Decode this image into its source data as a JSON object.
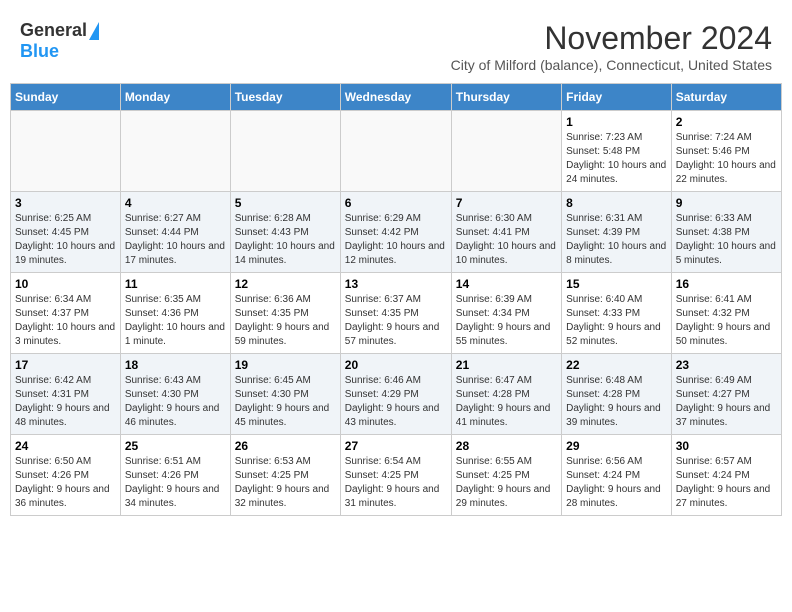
{
  "logo": {
    "general": "General",
    "blue": "Blue"
  },
  "title": "November 2024",
  "subtitle": "City of Milford (balance), Connecticut, United States",
  "days_of_week": [
    "Sunday",
    "Monday",
    "Tuesday",
    "Wednesday",
    "Thursday",
    "Friday",
    "Saturday"
  ],
  "weeks": [
    [
      {
        "day": "",
        "info": ""
      },
      {
        "day": "",
        "info": ""
      },
      {
        "day": "",
        "info": ""
      },
      {
        "day": "",
        "info": ""
      },
      {
        "day": "",
        "info": ""
      },
      {
        "day": "1",
        "info": "Sunrise: 7:23 AM\nSunset: 5:48 PM\nDaylight: 10 hours and 24 minutes."
      },
      {
        "day": "2",
        "info": "Sunrise: 7:24 AM\nSunset: 5:46 PM\nDaylight: 10 hours and 22 minutes."
      }
    ],
    [
      {
        "day": "3",
        "info": "Sunrise: 6:25 AM\nSunset: 4:45 PM\nDaylight: 10 hours and 19 minutes."
      },
      {
        "day": "4",
        "info": "Sunrise: 6:27 AM\nSunset: 4:44 PM\nDaylight: 10 hours and 17 minutes."
      },
      {
        "day": "5",
        "info": "Sunrise: 6:28 AM\nSunset: 4:43 PM\nDaylight: 10 hours and 14 minutes."
      },
      {
        "day": "6",
        "info": "Sunrise: 6:29 AM\nSunset: 4:42 PM\nDaylight: 10 hours and 12 minutes."
      },
      {
        "day": "7",
        "info": "Sunrise: 6:30 AM\nSunset: 4:41 PM\nDaylight: 10 hours and 10 minutes."
      },
      {
        "day": "8",
        "info": "Sunrise: 6:31 AM\nSunset: 4:39 PM\nDaylight: 10 hours and 8 minutes."
      },
      {
        "day": "9",
        "info": "Sunrise: 6:33 AM\nSunset: 4:38 PM\nDaylight: 10 hours and 5 minutes."
      }
    ],
    [
      {
        "day": "10",
        "info": "Sunrise: 6:34 AM\nSunset: 4:37 PM\nDaylight: 10 hours and 3 minutes."
      },
      {
        "day": "11",
        "info": "Sunrise: 6:35 AM\nSunset: 4:36 PM\nDaylight: 10 hours and 1 minute."
      },
      {
        "day": "12",
        "info": "Sunrise: 6:36 AM\nSunset: 4:35 PM\nDaylight: 9 hours and 59 minutes."
      },
      {
        "day": "13",
        "info": "Sunrise: 6:37 AM\nSunset: 4:35 PM\nDaylight: 9 hours and 57 minutes."
      },
      {
        "day": "14",
        "info": "Sunrise: 6:39 AM\nSunset: 4:34 PM\nDaylight: 9 hours and 55 minutes."
      },
      {
        "day": "15",
        "info": "Sunrise: 6:40 AM\nSunset: 4:33 PM\nDaylight: 9 hours and 52 minutes."
      },
      {
        "day": "16",
        "info": "Sunrise: 6:41 AM\nSunset: 4:32 PM\nDaylight: 9 hours and 50 minutes."
      }
    ],
    [
      {
        "day": "17",
        "info": "Sunrise: 6:42 AM\nSunset: 4:31 PM\nDaylight: 9 hours and 48 minutes."
      },
      {
        "day": "18",
        "info": "Sunrise: 6:43 AM\nSunset: 4:30 PM\nDaylight: 9 hours and 46 minutes."
      },
      {
        "day": "19",
        "info": "Sunrise: 6:45 AM\nSunset: 4:30 PM\nDaylight: 9 hours and 45 minutes."
      },
      {
        "day": "20",
        "info": "Sunrise: 6:46 AM\nSunset: 4:29 PM\nDaylight: 9 hours and 43 minutes."
      },
      {
        "day": "21",
        "info": "Sunrise: 6:47 AM\nSunset: 4:28 PM\nDaylight: 9 hours and 41 minutes."
      },
      {
        "day": "22",
        "info": "Sunrise: 6:48 AM\nSunset: 4:28 PM\nDaylight: 9 hours and 39 minutes."
      },
      {
        "day": "23",
        "info": "Sunrise: 6:49 AM\nSunset: 4:27 PM\nDaylight: 9 hours and 37 minutes."
      }
    ],
    [
      {
        "day": "24",
        "info": "Sunrise: 6:50 AM\nSunset: 4:26 PM\nDaylight: 9 hours and 36 minutes."
      },
      {
        "day": "25",
        "info": "Sunrise: 6:51 AM\nSunset: 4:26 PM\nDaylight: 9 hours and 34 minutes."
      },
      {
        "day": "26",
        "info": "Sunrise: 6:53 AM\nSunset: 4:25 PM\nDaylight: 9 hours and 32 minutes."
      },
      {
        "day": "27",
        "info": "Sunrise: 6:54 AM\nSunset: 4:25 PM\nDaylight: 9 hours and 31 minutes."
      },
      {
        "day": "28",
        "info": "Sunrise: 6:55 AM\nSunset: 4:25 PM\nDaylight: 9 hours and 29 minutes."
      },
      {
        "day": "29",
        "info": "Sunrise: 6:56 AM\nSunset: 4:24 PM\nDaylight: 9 hours and 28 minutes."
      },
      {
        "day": "30",
        "info": "Sunrise: 6:57 AM\nSunset: 4:24 PM\nDaylight: 9 hours and 27 minutes."
      }
    ]
  ]
}
